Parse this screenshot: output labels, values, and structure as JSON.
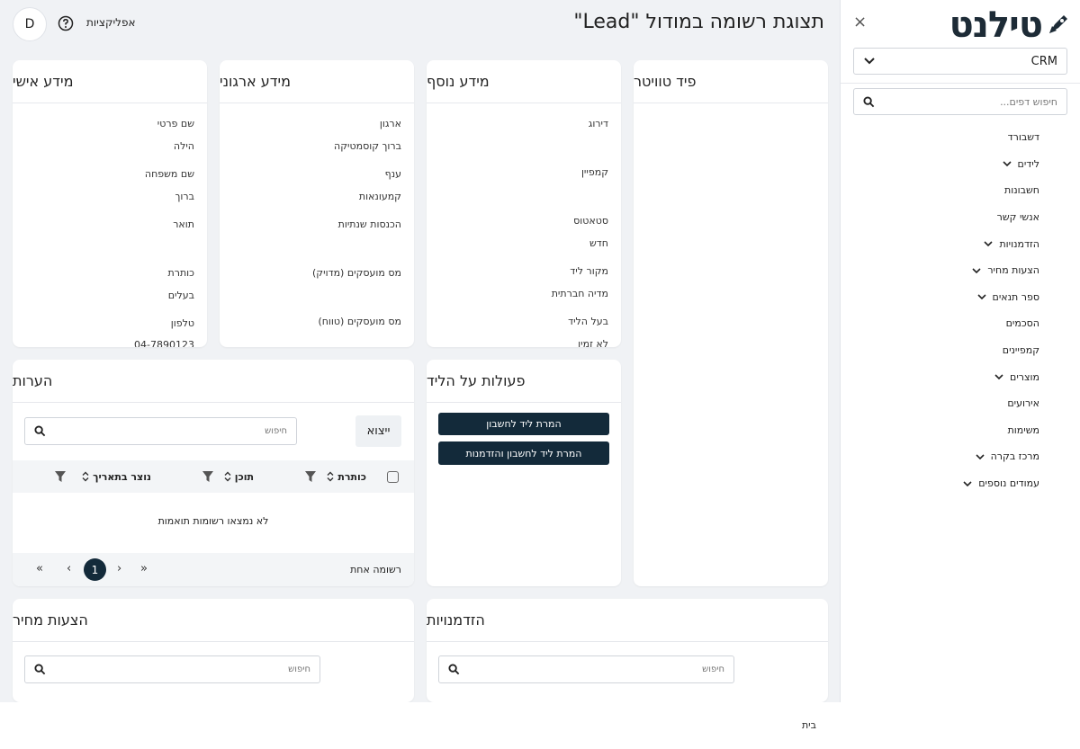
{
  "sidebar": {
    "logo_text": "טילנט",
    "close": "×",
    "module": "CRM",
    "search_placeholder": "חיפוש דפים...",
    "items": [
      {
        "label": "דשבורד",
        "has_children": false
      },
      {
        "label": "לידים",
        "has_children": true
      },
      {
        "label": "חשבונות",
        "has_children": false
      },
      {
        "label": "אנשי קשר",
        "has_children": false
      },
      {
        "label": "הזדמנויות",
        "has_children": true
      },
      {
        "label": "הצעות מחיר",
        "has_children": true
      },
      {
        "label": "ספר תנאים",
        "has_children": true
      },
      {
        "label": "הסכמים",
        "has_children": false
      },
      {
        "label": "קמפיינים",
        "has_children": false
      },
      {
        "label": "מוצרים",
        "has_children": true
      },
      {
        "label": "אירועים",
        "has_children": false
      },
      {
        "label": "משימות",
        "has_children": false
      },
      {
        "label": "מרכז בקרה",
        "has_children": true
      },
      {
        "label": "עמודים נוספים",
        "has_children": true
      }
    ]
  },
  "topbar": {
    "avatar": "D",
    "apps": "אפליקציות",
    "title": "תצוגת רשומה במודול \"Lead\""
  },
  "personal": {
    "title": "מידע אישי",
    "first_name_label": "שם פרטי",
    "first_name": "הילה",
    "last_name_label": "שם משפחה",
    "last_name": "ברוך",
    "prefix_label": "תואר",
    "job_title_label": "כותרת",
    "job_title": "בעלים",
    "phone_label": "טלפון",
    "phone": "04-7890123"
  },
  "org": {
    "title": "מידע ארגוני",
    "org_label": "ארגון",
    "org": "ברוך קוסמטיקה",
    "industry_label": "ענף",
    "industry": "קמעונאות",
    "revenue_label": "הכנסות שנתיות",
    "emp_exact_label": "מס מועסקים (מדויק)",
    "emp_range_label": "מס מועסקים (טווח)"
  },
  "extra": {
    "title": "מידע נוסף",
    "rating_label": "דירוג",
    "campaign_label": "קמפיין",
    "status_label": "סטאטוס",
    "status": "חדש",
    "source_label": "מקור ליד",
    "source": "מדיה חברתית",
    "owner_label": "בעל הליד",
    "owner": "לא זמין"
  },
  "twitter": {
    "title": "פיד טוויטר"
  },
  "notes": {
    "title": "הערות",
    "export": "ייצוא",
    "search_placeholder": "חיפוש",
    "col_title": "כותרת",
    "col_content": "תוכן",
    "col_created": "נוצר בתאריך",
    "empty": "לא נמצאו רשומות תואמות",
    "count": "רשומה אחת",
    "page": "1"
  },
  "actions": {
    "title": "פעולות על הליד",
    "convert_account": "המרת ליד לחשבון",
    "convert_account_opp": "המרת ליד לחשבון והזדמנות"
  },
  "quotes": {
    "title": "הצעות מחיר",
    "search_placeholder": "חיפוש"
  },
  "opportunities": {
    "title": "הזדמנויות",
    "search_placeholder": "חיפוש"
  },
  "footer": {
    "home": "בית"
  }
}
